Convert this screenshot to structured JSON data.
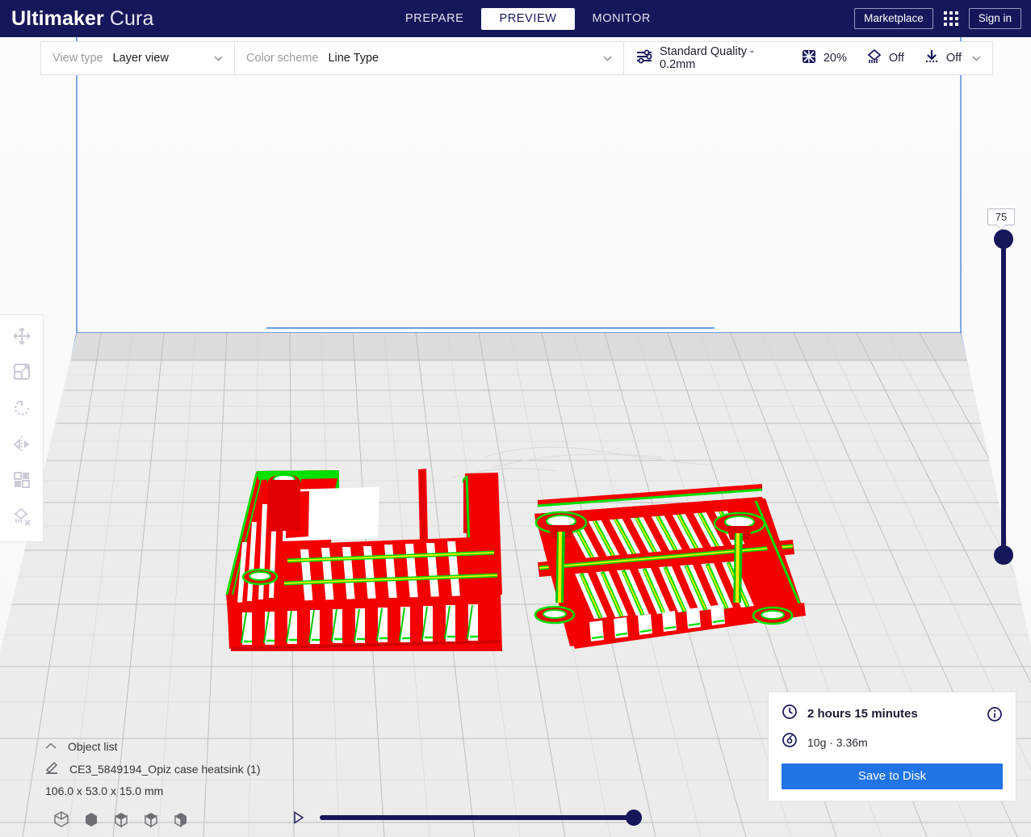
{
  "app": {
    "brand_bold": "Ultimaker",
    "brand_light": "Cura"
  },
  "titlebar": {
    "tabs": [
      {
        "label": "PREPARE",
        "active": false
      },
      {
        "label": "PREVIEW",
        "active": true
      },
      {
        "label": "MONITOR",
        "active": false
      }
    ],
    "marketplace_label": "Marketplace",
    "signin_label": "Sign in",
    "apps_icon": "grid-apps-icon",
    "background_color": "#16165a"
  },
  "settings_bar": {
    "view_type": {
      "label": "View type",
      "value": "Layer view",
      "chevron": "chevron-down-icon"
    },
    "color_scheme": {
      "label": "Color scheme",
      "value": "Line Type",
      "chevron": "chevron-down-icon"
    },
    "print_settings": {
      "quality_icon": "print-settings-sliders-icon",
      "quality": "Standard Quality - 0.2mm",
      "infill_icon": "infill-icon",
      "infill": "20%",
      "support_icon": "support-icon",
      "support": "Off",
      "adhesion_icon": "adhesion-icon",
      "adhesion": "Off",
      "chevron": "chevron-down-icon"
    }
  },
  "toolbar": {
    "tools": [
      {
        "name": "move-tool",
        "icon": "move-icon",
        "enabled": false
      },
      {
        "name": "scale-tool",
        "icon": "scale-icon",
        "enabled": false
      },
      {
        "name": "rotate-tool",
        "icon": "rotate-icon",
        "enabled": false
      },
      {
        "name": "mirror-tool",
        "icon": "mirror-icon",
        "enabled": false
      },
      {
        "name": "per-model-settings-tool",
        "icon": "per-model-settings-icon",
        "enabled": false
      },
      {
        "name": "support-blocker-tool",
        "icon": "support-blocker-icon",
        "enabled": false
      }
    ]
  },
  "layer_slider": {
    "value": "75",
    "top_handle": "layer-slider-top-handle",
    "bottom_handle": "layer-slider-bottom-handle"
  },
  "object_list": {
    "title": "Object list",
    "collapse_icon": "chevron-up-icon",
    "item_icon": "mesh-type-icon",
    "item_name": "CE3_5849194_Opiz case heatsink (1)",
    "dimensions": "106.0 x 53.0 x 15.0 mm"
  },
  "bottom_bar": {
    "view_cubes": [
      "isometric-view-icon",
      "front-view-icon",
      "top-view-icon",
      "left-view-icon",
      "right-view-icon"
    ],
    "play_icon": "play-icon",
    "simulation_value": 100
  },
  "print_info": {
    "time_icon": "clock-icon",
    "time": "2 hours 15 minutes",
    "info_icon": "info-icon",
    "material_icon": "filament-spool-icon",
    "material": "10g · 3.36m",
    "save_label": "Save to Disk",
    "save_color": "#2074e6"
  },
  "scene": {
    "build_plate_color": "#e9e9e9",
    "grid_line_color": "#b9b9b9",
    "volume_outline_color": "#2f6fd0",
    "background_color": "#fafafa",
    "line_colors": {
      "walls": "#f40000",
      "skin": "#00e000",
      "inner_wall": "#ffe600"
    },
    "models": [
      {
        "name": "case-frame-model",
        "shape": "u-shaped-case"
      },
      {
        "name": "heatsink-grille-model",
        "shape": "slatted-plate"
      }
    ]
  }
}
